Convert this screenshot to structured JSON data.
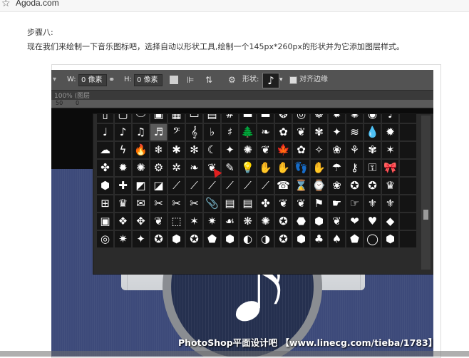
{
  "browser": {
    "star_icon": "star-icon",
    "bookmark": "Agoda.com"
  },
  "article": {
    "step": "步骤八:",
    "description": "现在我们来绘制一下音乐图标吧，选择自动以形状工具,绘制一个145px*260px的形状并为它添加图层样式。"
  },
  "optbar": {
    "w_label": "W:",
    "w_value": "0 像素",
    "h_label": "H:",
    "h_value": "0 像素",
    "shape_label": "形状:",
    "align_label": "对齐边缘",
    "shape_glyph": "♪"
  },
  "doc": {
    "tab": "100% (图层",
    "ruler_50": "50",
    "ruler_0": "0"
  },
  "shapes": [
    "▯",
    "▢",
    "⬭",
    "▣",
    "▦",
    "▭",
    "▤",
    "#",
    "▬",
    "▬",
    "❂",
    "◎",
    "❁",
    "✹",
    "✺",
    "◉",
    "♩",
    "",
    "♩",
    "♪",
    "♫",
    "♬",
    "𝄢",
    "𝄞",
    "♭",
    "♯",
    "🌲",
    "❧",
    "✿",
    "❦",
    "✾",
    "✦",
    "≋",
    "💧",
    "✹",
    "",
    "☁",
    "ϟ",
    "🔥",
    "❄",
    "✱",
    "✻",
    "☾",
    "✦",
    "✺",
    "❦",
    "🍁",
    "✿",
    "✧",
    "❀",
    "⚘",
    "✾",
    "✶",
    "",
    "✤",
    "✹",
    "✺",
    "⚙",
    "✲",
    "❧",
    "❦",
    "✎",
    "💡",
    "✋",
    "✋",
    "👣",
    "✋",
    "☂",
    "⚷",
    "⚿",
    "🎀",
    "",
    "⬢",
    "✚",
    "◩",
    "◪",
    "⟋",
    "⟋",
    "⟋",
    "⟋",
    "⟋",
    "⟋",
    "☎",
    "⌛",
    "⌚",
    "❀",
    "✪",
    "✪",
    "♛",
    "",
    "⊞",
    "♛",
    "✉",
    "✂",
    "✂",
    "✂",
    "📎",
    "▤",
    "▤",
    "✤",
    "❦",
    "❦",
    "⚑",
    "☛",
    "☞",
    "⚜",
    "⚜",
    "",
    "▣",
    "❖",
    "✥",
    "❦",
    "⬚",
    "✶",
    "✷",
    "☙",
    "❋",
    "✺",
    "✪",
    "⬣",
    "⬢",
    "❦",
    "❤",
    "♥",
    "◆",
    "",
    "◎",
    "✷",
    "✦",
    "✪",
    "⬢",
    "✪",
    "⬟",
    "⬢",
    "◐",
    "◑",
    "✪",
    "⬢",
    "♣",
    "♠",
    "⬟",
    "◯",
    "⬢",
    ""
  ],
  "selected_index": 21,
  "watermark": "PhotoShop平面设计吧 【www.linecg.com/tieba/1783】"
}
